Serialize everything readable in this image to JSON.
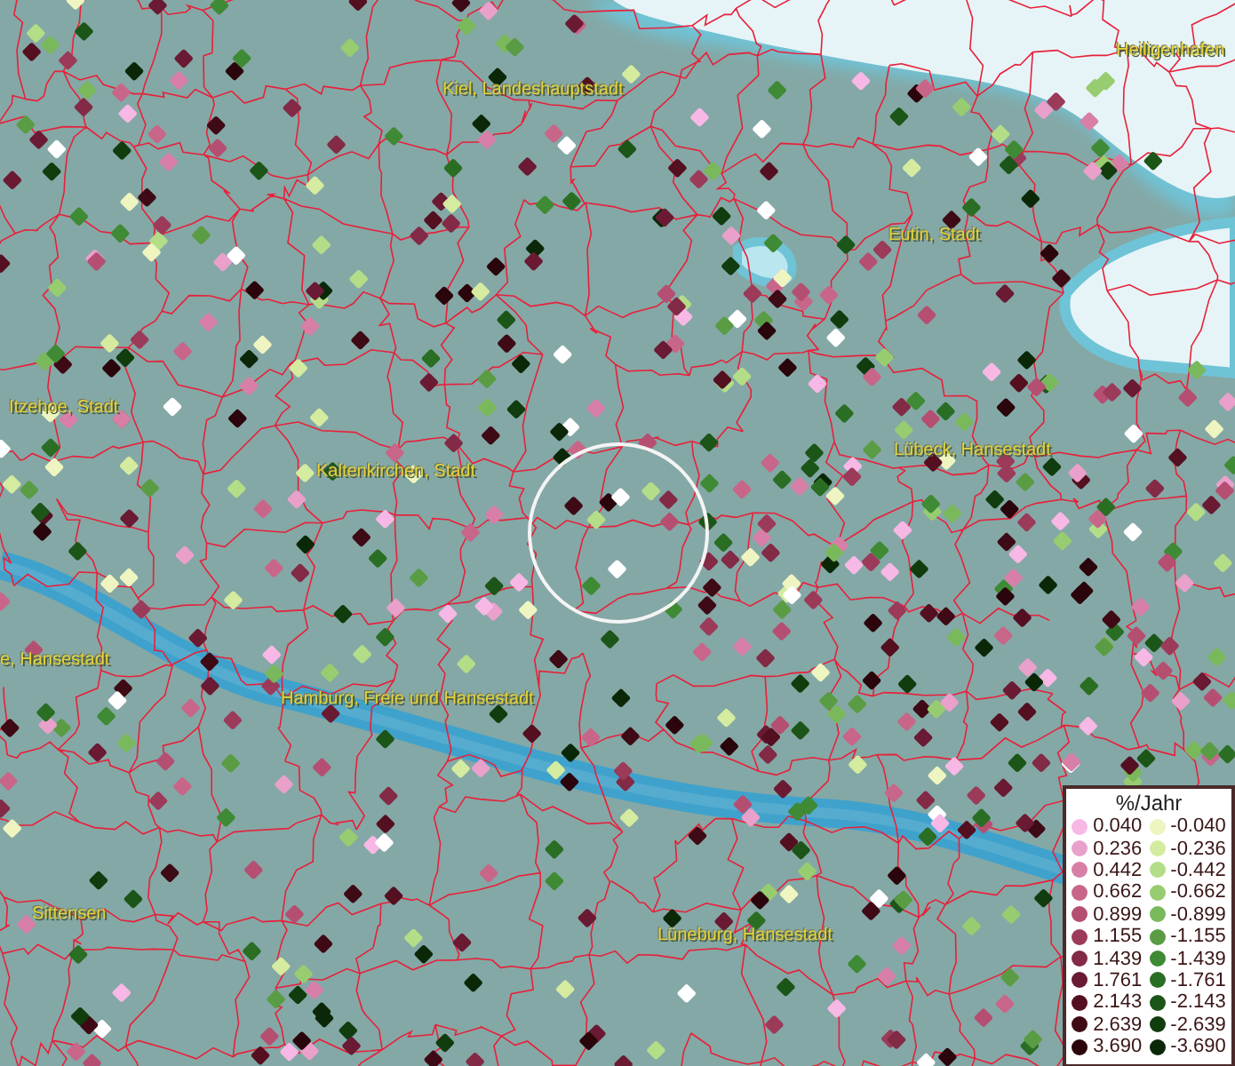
{
  "map": {
    "places": [
      {
        "name": "Kiel, Landeshauptstadt"
      },
      {
        "name": "Heiligenhafen"
      },
      {
        "name": "Eutin, Stadt"
      },
      {
        "name": "Itzehoe, Stadt"
      },
      {
        "name": "Kaltenkirchen, Stadt"
      },
      {
        "name": "Lübeck, Hansestadt"
      },
      {
        "name": "e, Hansestadt"
      },
      {
        "name": "Hamburg, Freie und Hansestadt"
      },
      {
        "name": "Sittensen"
      },
      {
        "name": "Lüneburg, Hansestadt"
      }
    ]
  },
  "legend": {
    "title": "%/Jahr",
    "positive": [
      {
        "label": "0.040",
        "color": "#f7b8e6"
      },
      {
        "label": "0.236",
        "color": "#e9a0cb"
      },
      {
        "label": "0.442",
        "color": "#d87fa8"
      },
      {
        "label": "0.662",
        "color": "#c8668a"
      },
      {
        "label": "0.899",
        "color": "#b54f72"
      },
      {
        "label": "1.155",
        "color": "#9c3a5a"
      },
      {
        "label": "1.439",
        "color": "#822a46"
      },
      {
        "label": "1.761",
        "color": "#6a1a33"
      },
      {
        "label": "2.143",
        "color": "#541020"
      },
      {
        "label": "2.639",
        "color": "#3e0a15"
      },
      {
        "label": "3.690",
        "color": "#2a050b"
      }
    ],
    "negative": [
      {
        "label": "-0.040",
        "color": "#eef5c0"
      },
      {
        "label": "-0.236",
        "color": "#d4eba0"
      },
      {
        "label": "-0.442",
        "color": "#b4dd88"
      },
      {
        "label": "-0.662",
        "color": "#98cc70"
      },
      {
        "label": "-0.899",
        "color": "#7ab85c"
      },
      {
        "label": "-1.155",
        "color": "#5a9c44"
      },
      {
        "label": "-1.439",
        "color": "#3f8a34"
      },
      {
        "label": "-1.761",
        "color": "#2a6e24"
      },
      {
        "label": "-2.143",
        "color": "#1c5518"
      },
      {
        "label": "-2.639",
        "color": "#103c0e"
      },
      {
        "label": "-3.690",
        "color": "#0a2808"
      }
    ]
  }
}
